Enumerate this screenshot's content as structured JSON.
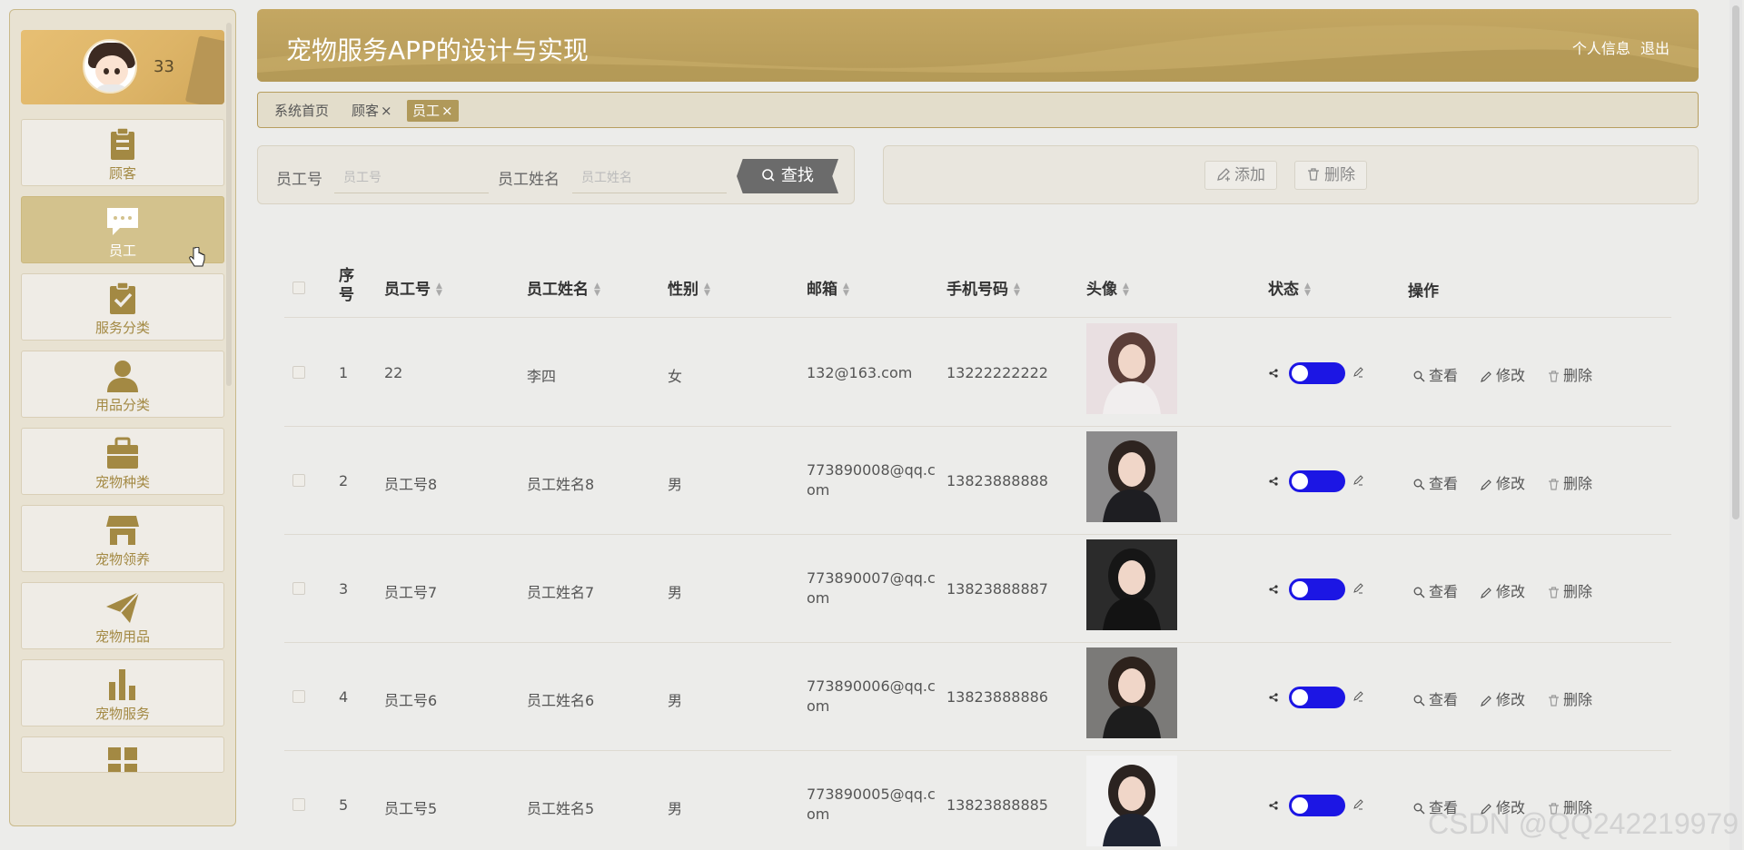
{
  "app": {
    "title": "宠物服务APP的设计与实现",
    "profile_link": "个人信息",
    "logout_link": "退出"
  },
  "user": {
    "name": "33"
  },
  "sidebar": {
    "items": [
      {
        "label": "顾客",
        "icon": "clipboard-icon"
      },
      {
        "label": "员工",
        "icon": "chat-icon",
        "active": true
      },
      {
        "label": "服务分类",
        "icon": "clipboard-check-icon"
      },
      {
        "label": "用品分类",
        "icon": "user-icon"
      },
      {
        "label": "宠物种类",
        "icon": "briefcase-icon"
      },
      {
        "label": "宠物领养",
        "icon": "shop-icon"
      },
      {
        "label": "宠物用品",
        "icon": "paper-plane-icon"
      },
      {
        "label": "宠物服务",
        "icon": "bar-chart-icon"
      },
      {
        "label": "",
        "icon": "grid-icon"
      }
    ]
  },
  "tags": {
    "home": "系统首页",
    "customer": "顾客",
    "employee": "员工",
    "close": "×"
  },
  "search": {
    "emp_no_label": "员工号",
    "emp_no_placeholder": "员工号",
    "emp_name_label": "员工姓名",
    "emp_name_placeholder": "员工姓名",
    "button": "查找"
  },
  "actions": {
    "add": "添加",
    "delete": "删除"
  },
  "table": {
    "columns": [
      "序号",
      "员工号",
      "员工姓名",
      "性别",
      "邮箱",
      "手机号码",
      "头像",
      "状态",
      "操作"
    ],
    "ops": {
      "view": "查看",
      "edit": "修改",
      "delete": "删除"
    },
    "rows": [
      {
        "index": "1",
        "emp_no": "22",
        "name": "李四",
        "gender": "女",
        "email_1": "132@163.com",
        "email_2": "",
        "phone": "13222222222",
        "status_on": true
      },
      {
        "index": "2",
        "emp_no": "员工号8",
        "name": "员工姓名8",
        "gender": "男",
        "email_1": "773890008@qq.c",
        "email_2": "om",
        "phone": "13823888888",
        "status_on": true
      },
      {
        "index": "3",
        "emp_no": "员工号7",
        "name": "员工姓名7",
        "gender": "男",
        "email_1": "773890007@qq.c",
        "email_2": "om",
        "phone": "13823888887",
        "status_on": true
      },
      {
        "index": "4",
        "emp_no": "员工号6",
        "name": "员工姓名6",
        "gender": "男",
        "email_1": "773890006@qq.c",
        "email_2": "om",
        "phone": "13823888886",
        "status_on": true
      },
      {
        "index": "5",
        "emp_no": "员工号5",
        "name": "员工姓名5",
        "gender": "男",
        "email_1": "773890005@qq.c",
        "email_2": "om",
        "phone": "13823888885",
        "status_on": true
      }
    ]
  },
  "watermark": "CSDN @QQ242219979",
  "colors": {
    "accent": "#b59a58",
    "toggle": "#1c16e4",
    "active_menu": "#d3c28d"
  }
}
